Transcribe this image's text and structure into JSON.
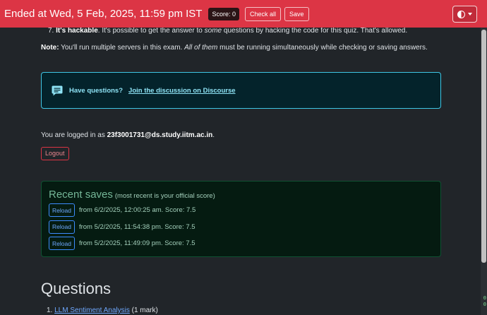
{
  "navbar": {
    "title": "Ended at Wed, 5 Feb, 2025, 11:59 pm IST",
    "score_badge": "Score: 0",
    "check_all": "Check all",
    "save": "Save"
  },
  "intro": {
    "item7_num": "7.",
    "item7_bold": "It's hackable",
    "item7_text": ". It's possible to get the answer to ",
    "item7_em": "some",
    "item7_text2": " questions by hacking the code for this quiz. That's allowed.",
    "note_label": "Note:",
    "note_text": " You'll run multiple servers in this exam. ",
    "note_em": "All of them",
    "note_text2": " must be running simultaneously while checking or saving answers."
  },
  "discourse": {
    "question": "Have questions?",
    "link": "Join the discussion on Discourse"
  },
  "login": {
    "prefix": "You are logged in as ",
    "email": "23f3001731@ds.study.iitm.ac.in",
    "suffix": ".",
    "logout": "Logout"
  },
  "recent_saves": {
    "title": "Recent saves",
    "subtitle": "(most recent is your official score)",
    "reload_label": "Reload",
    "rows": [
      "from 6/2/2025, 12:00:25 am. Score: 7.5",
      "from 5/2/2025, 11:54:38 pm. Score: 7.5",
      "from 5/2/2025, 11:49:09 pm. Score: 7.5"
    ]
  },
  "questions": {
    "heading": "Questions",
    "q1_num": "1.",
    "q1_link": "LLM Sentiment Analysis",
    "q1_marks": " (1 mark)"
  },
  "edge_text": "0\n0",
  "colors": {
    "navbar": "#dc3545",
    "background": "#212529",
    "info_border": "#3fc6e4",
    "success_text": "#75b798",
    "link": "#6ea8fe"
  }
}
